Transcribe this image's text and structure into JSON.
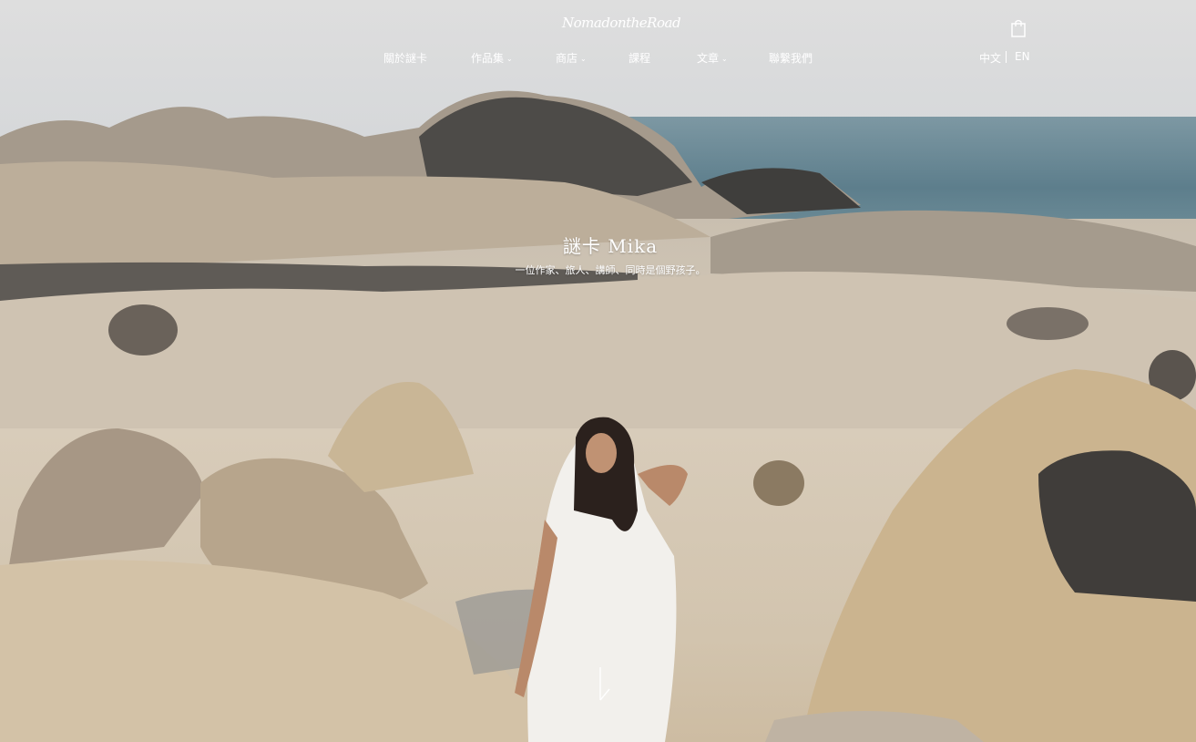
{
  "header": {
    "logo_text": "NomadontheRoad",
    "nav": [
      {
        "label": "關於謎卡",
        "has_dropdown": false
      },
      {
        "label": "作品集",
        "has_dropdown": true
      },
      {
        "label": "商店",
        "has_dropdown": true
      },
      {
        "label": "課程",
        "has_dropdown": false
      },
      {
        "label": "文章",
        "has_dropdown": true
      },
      {
        "label": "聯繫我們",
        "has_dropdown": false
      }
    ],
    "icons": {
      "cart": "shopping-bag-icon",
      "dropdown": "chevron-down-icon",
      "scroll": "arrow-down-icon"
    },
    "lang": {
      "zh": "中文",
      "en": "EN"
    }
  },
  "hero": {
    "title": "謎卡 Mika",
    "subtitle": "一位作家、旅人、講師、同時是個野孩子。"
  },
  "colors": {
    "text": "#ffffff",
    "sea": "#5d7e8c",
    "sand": "#d6c9b5"
  }
}
